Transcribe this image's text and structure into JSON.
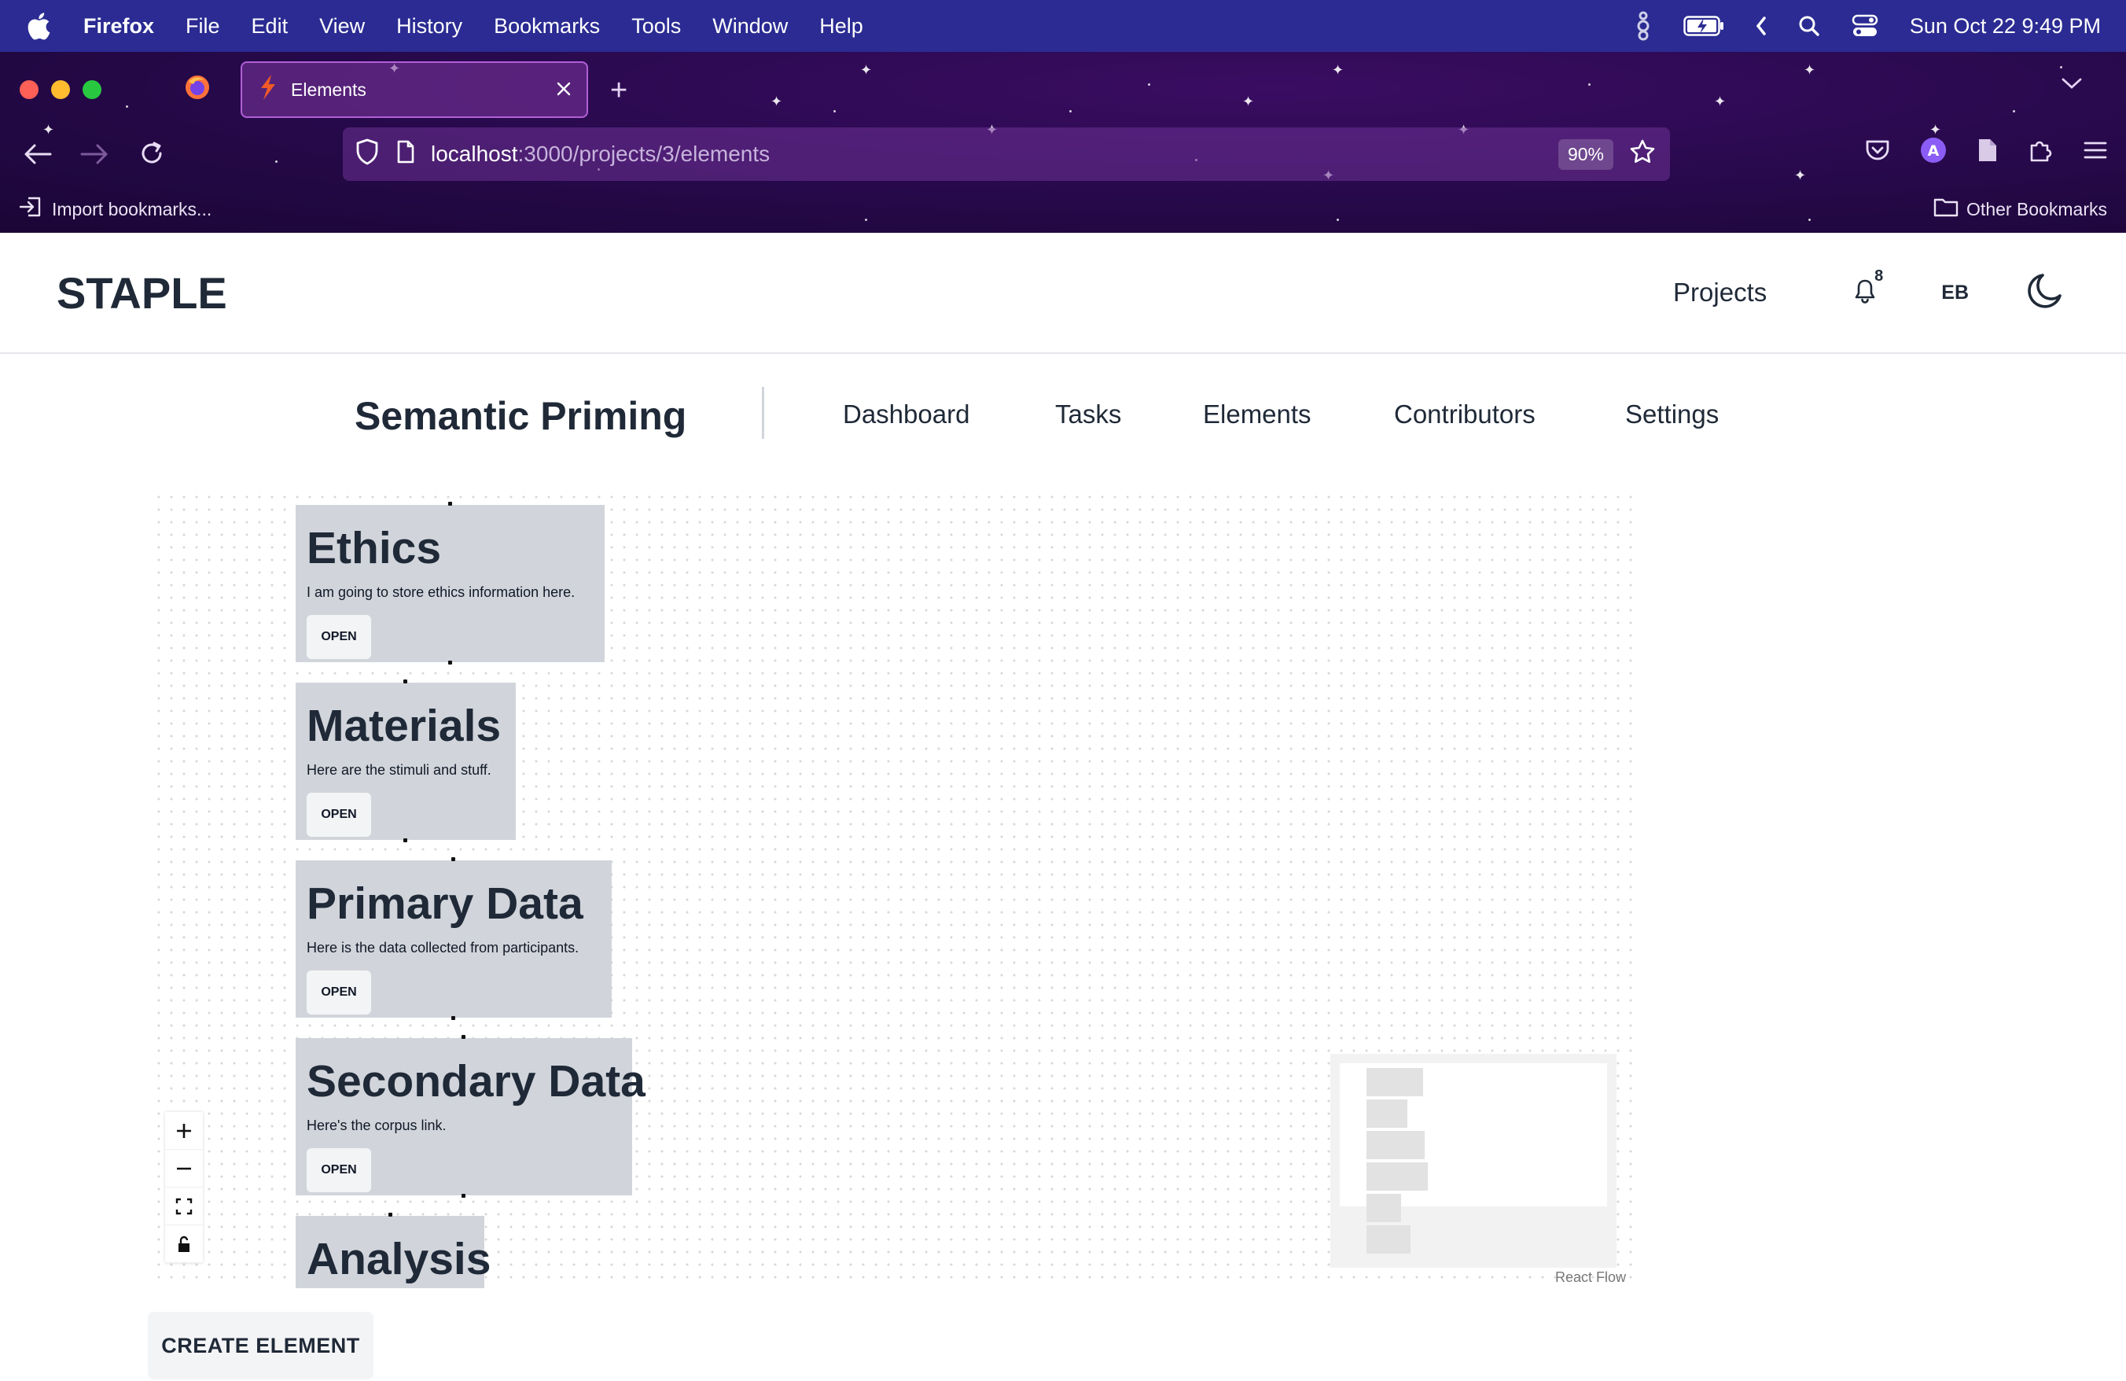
{
  "menubar": {
    "app_name": "Firefox",
    "items": [
      "File",
      "Edit",
      "View",
      "History",
      "Bookmarks",
      "Tools",
      "Window",
      "Help"
    ],
    "clock": "Sun Oct 22  9:49 PM"
  },
  "browser": {
    "tab_title": "Elements",
    "url_host": "localhost",
    "url_path": ":3000/projects/3/elements",
    "zoom": "90%",
    "bookmarks": {
      "import_label": "Import bookmarks...",
      "other_label": "Other Bookmarks"
    }
  },
  "header": {
    "logo": "STAPLE",
    "projects_label": "Projects",
    "notification_count": "8",
    "avatar_initials": "EB"
  },
  "project": {
    "title": "Semantic Priming",
    "nav": [
      "Dashboard",
      "Tasks",
      "Elements",
      "Contributors",
      "Settings"
    ]
  },
  "flow": {
    "nodes": [
      {
        "title": "Ethics",
        "description": "I am going to store ethics information here.",
        "button": "OPEN"
      },
      {
        "title": "Materials",
        "description": "Here are the stimuli and stuff.",
        "button": "OPEN"
      },
      {
        "title": "Primary Data",
        "description": "Here is the data collected from participants.",
        "button": "OPEN"
      },
      {
        "title": "Secondary Data",
        "description": "Here's the corpus link.",
        "button": "OPEN"
      },
      {
        "title": "Analysis",
        "description": "",
        "button": ""
      }
    ],
    "controls": [
      "zoom-in",
      "zoom-out",
      "fit-view",
      "lock"
    ],
    "attribution": "React Flow"
  },
  "actions": {
    "create_element": "CREATE ELEMENT"
  },
  "colors": {
    "menubar_bg": "#2b2b93",
    "chrome_bg": "#26094a",
    "node_bg": "#d1d5db",
    "text_dark": "#1f2937"
  }
}
